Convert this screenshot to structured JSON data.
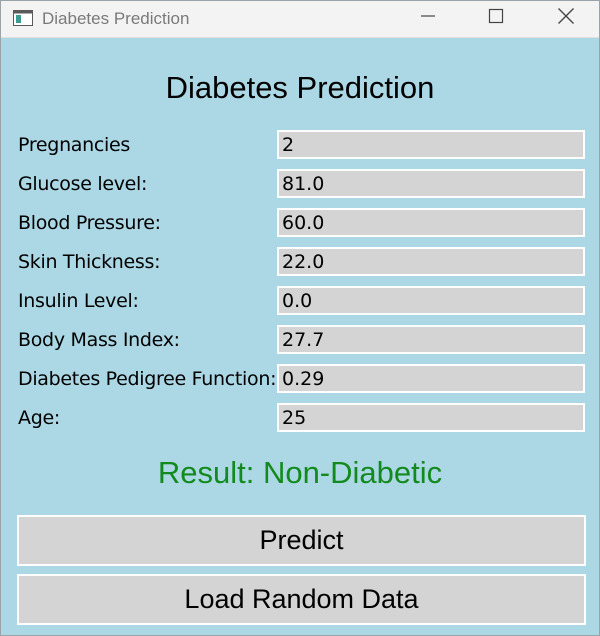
{
  "window": {
    "title": "Diabetes Prediction",
    "controls": {
      "minimize": "minimize",
      "maximize": "maximize",
      "close": "close"
    }
  },
  "form": {
    "heading": "Diabetes Prediction",
    "fields": [
      {
        "label": "Pregnancies",
        "value": "2"
      },
      {
        "label": "Glucose level:",
        "value": "81.0"
      },
      {
        "label": "Blood Pressure:",
        "value": "60.0"
      },
      {
        "label": "Skin Thickness:",
        "value": "22.0"
      },
      {
        "label": "Insulin Level:",
        "value": "0.0"
      },
      {
        "label": "Body Mass Index:",
        "value": "27.7"
      },
      {
        "label": "Diabetes Pedigree Function:",
        "value": "0.29"
      },
      {
        "label": "Age:",
        "value": "25"
      }
    ],
    "result": "Result: Non-Diabetic",
    "predict_label": "Predict",
    "load_random_label": "Load Random Data"
  },
  "colors": {
    "background": "#acd8e5",
    "result": "#138a1e",
    "input_bg": "#d4d4d4"
  },
  "icons": {
    "app": "app-window-icon",
    "minimize": "minimize-icon",
    "maximize": "maximize-icon",
    "close": "close-icon"
  }
}
